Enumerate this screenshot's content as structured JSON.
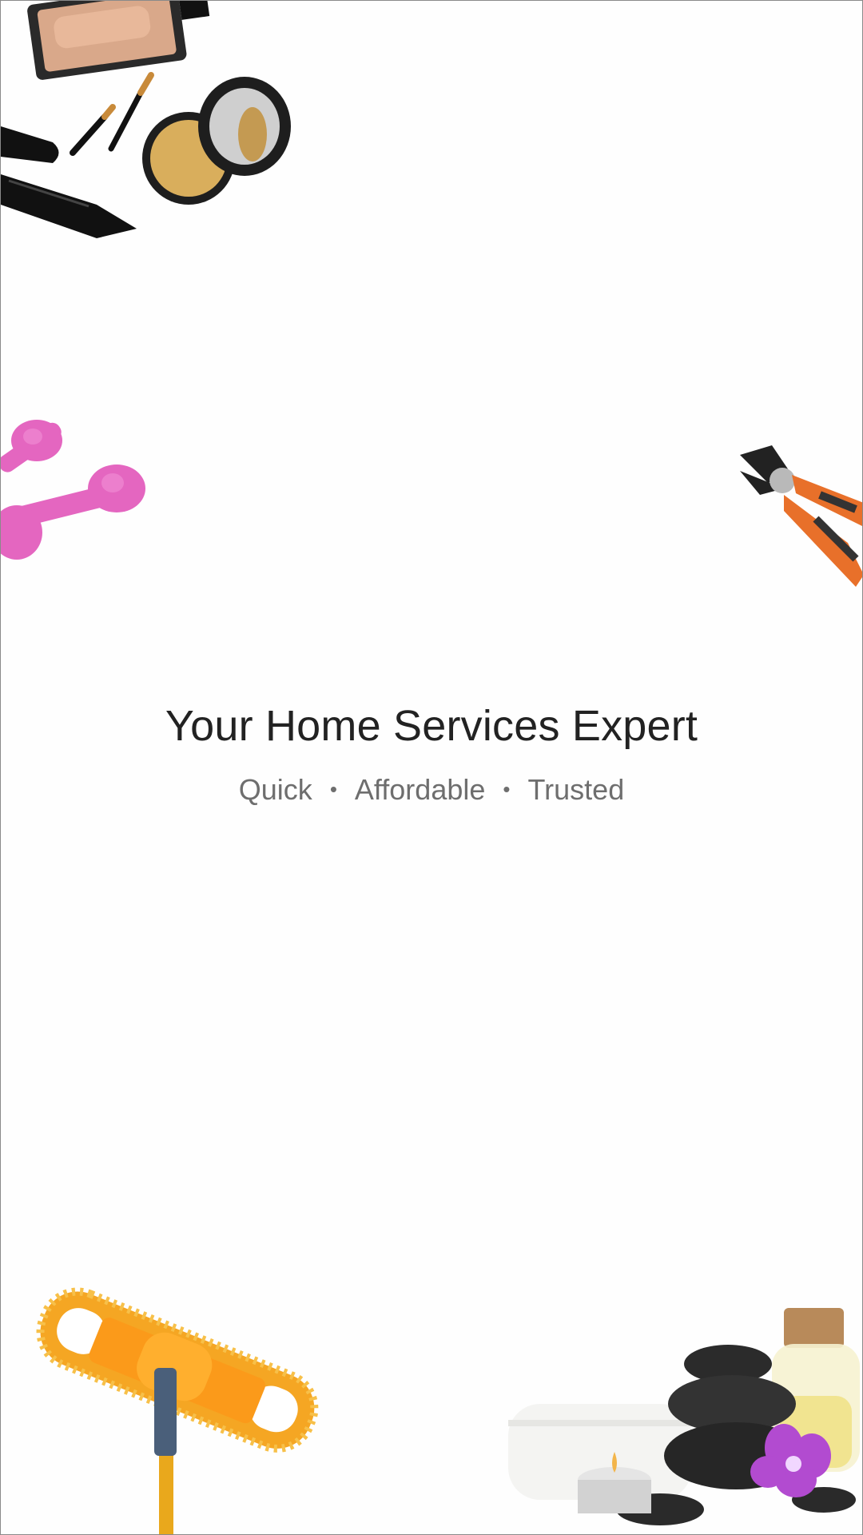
{
  "splash": {
    "headline": "Your Home Services Expert",
    "tags": [
      "Quick",
      "Affordable",
      "Trusted"
    ],
    "separator": "•"
  },
  "decorations": [
    {
      "name": "perfume-bottle-icon"
    },
    {
      "name": "makeup-brushes-icon"
    },
    {
      "name": "compact-powder-icon"
    },
    {
      "name": "mascara-icon"
    },
    {
      "name": "dumbbells-icon"
    },
    {
      "name": "pliers-icon"
    },
    {
      "name": "mop-icon"
    },
    {
      "name": "spa-stones-icon"
    }
  ],
  "colors": {
    "background": "#fefefe",
    "headline": "#222222",
    "subline": "#6e6e6e",
    "dumbbell": "#e466c0",
    "pliers": "#e8702a",
    "mop": "#f5a623"
  }
}
